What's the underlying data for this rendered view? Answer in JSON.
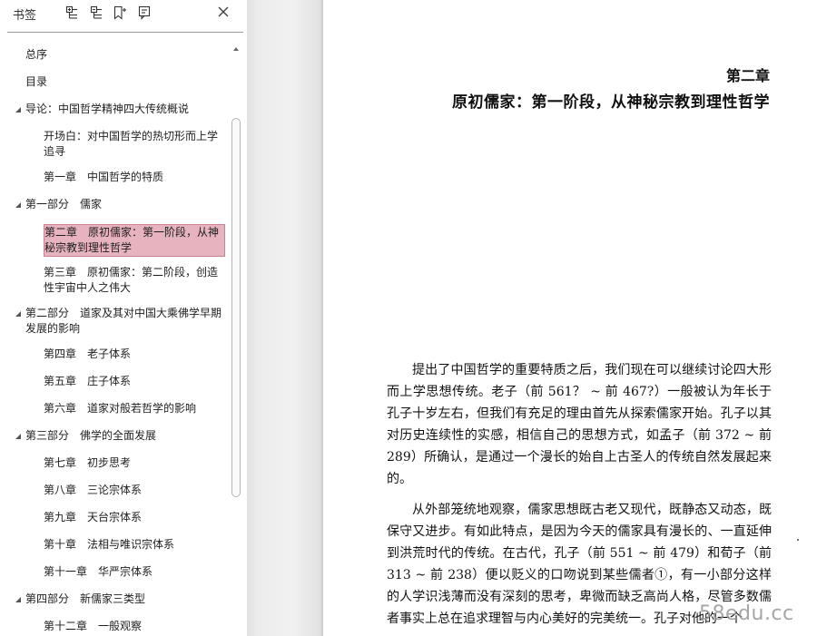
{
  "sidebar": {
    "title": "书签",
    "tools": [
      "expand-all-icon",
      "collapse-all-icon",
      "add-bookmark-icon",
      "bookmark-properties-icon"
    ],
    "items": [
      {
        "label": "总序",
        "level": 1,
        "toggle": false
      },
      {
        "label": "目录",
        "level": 1,
        "toggle": false
      },
      {
        "label": "导论：中国哲学精神四大传统概说",
        "level": 1,
        "toggle": true
      },
      {
        "label": "开场白：对中国哲学的热切形而上学追寻",
        "level": 2,
        "toggle": false
      },
      {
        "label": "第一章　中国哲学的特质",
        "level": 2,
        "toggle": false
      },
      {
        "label": "第一部分　儒家",
        "level": 1,
        "toggle": true
      },
      {
        "label": "第二章　原初儒家：第一阶段，从神秘宗教到理性哲学",
        "level": 2,
        "toggle": false,
        "selected": true
      },
      {
        "label": "第三章　原初儒家：第二阶段，创造性宇宙中人之伟大",
        "level": 2,
        "toggle": false
      },
      {
        "label": "第二部分　道家及其对中国大乘佛学早期发展的影响",
        "level": 1,
        "toggle": true
      },
      {
        "label": "第四章　老子体系",
        "level": 2,
        "toggle": false
      },
      {
        "label": "第五章　庄子体系",
        "level": 2,
        "toggle": false
      },
      {
        "label": "第六章　道家对般若哲学的影响",
        "level": 2,
        "toggle": false
      },
      {
        "label": "第三部分　佛学的全面发展",
        "level": 1,
        "toggle": true
      },
      {
        "label": "第七章　初步思考",
        "level": 2,
        "toggle": false
      },
      {
        "label": "第八章　三论宗体系",
        "level": 2,
        "toggle": false
      },
      {
        "label": "第九章　天台宗体系",
        "level": 2,
        "toggle": false
      },
      {
        "label": "第十章　法相与唯识宗体系",
        "level": 2,
        "toggle": false
      },
      {
        "label": "第十一章　华严宗体系",
        "level": 2,
        "toggle": false
      },
      {
        "label": "第四部分　新儒家三类型",
        "level": 1,
        "toggle": true
      },
      {
        "label": "第十二章　一般观察",
        "level": 2,
        "toggle": false
      }
    ]
  },
  "page": {
    "chapter_number": "第二章",
    "chapter_title": "原初儒家：第一阶段，从神秘宗教到理性哲学",
    "paragraph_1": "提出了中国哲学的重要特质之后，我们现在可以继续讨论四大形而上学思想传统。老子（前 561？ ~ 前 467?）一般被认为年长于孔子十岁左右，但我们有充足的理由首先从探索儒家开始。孔子以其对历史连续性的实感，相信自己的思想方式，如孟子（前 372 ~ 前 289）所确认，是通过一个漫长的始自上古圣人的传统自然发展起来的。",
    "paragraph_2": "从外部笼统地观察，儒家思想既古老又现代，既静态又动态，既保守又进步。有如此特点，是因为今天的儒家具有漫长的、一直延伸到洪荒时代的传统。在古代，孔子（前 551 ~ 前 479）和荀子（前 313 ~ 前 238）便以贬义的口吻说到某些儒者①，有一小部分这样的人学识浅薄而没有深刻的思考，卑微而缺乏高尚人格，尽管多数儒者事实上总在追求理智与内心美好的完美统一。孔子对他的一个"
  },
  "watermark": "58edu.cc",
  "colors": {
    "selected_bg": "#e6b3bf",
    "selected_border": "#c9828f",
    "gutter": "#ececec"
  }
}
